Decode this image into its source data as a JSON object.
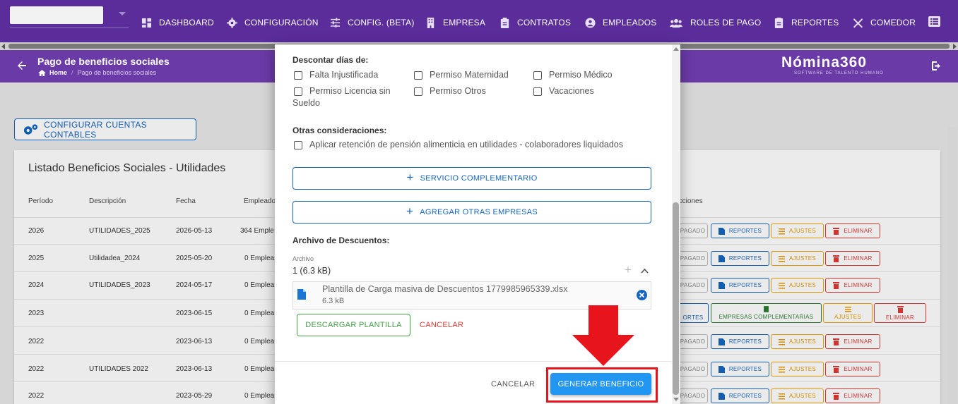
{
  "nav": {
    "items": [
      {
        "label": "DASHBOARD",
        "icon": "dashboard-icon"
      },
      {
        "label": "CONFIGURACIÓN",
        "icon": "gear-icon"
      },
      {
        "label": "CONFIG. (BETA)",
        "icon": "tune-icon"
      },
      {
        "label": "EMPRESA",
        "icon": "building-icon"
      },
      {
        "label": "CONTRATOS",
        "icon": "clipboard-icon"
      },
      {
        "label": "EMPLEADOS",
        "icon": "employees-icon"
      },
      {
        "label": "ROLES DE PAGO",
        "icon": "group-icon"
      },
      {
        "label": "REPORTES",
        "icon": "report-icon"
      },
      {
        "label": "COMEDOR",
        "icon": "cutlery-icon"
      }
    ]
  },
  "header": {
    "title": "Pago de beneficios sociales",
    "breadcrumb": {
      "home": "Home",
      "current": "Pago de beneficios sociales"
    },
    "logo": "Nómina360",
    "logo_sub": "SOFTWARE DE TALENTO HUMANO"
  },
  "background": {
    "config_button": "CONFIGURAR CUENTAS CONTABLES",
    "card_title": "Listado Beneficios Sociales - Utilidades",
    "columns": [
      "Período",
      "Descripción",
      "Fecha",
      "Empleado",
      "Acciones"
    ],
    "rows": [
      {
        "periodo": "2026",
        "descripcion": "UTILIDADES_2025",
        "fecha": "2026-05-13",
        "empleados": "364 Emple"
      },
      {
        "periodo": "2025",
        "descripcion": "Utilidadea_2024",
        "fecha": "2025-05-20",
        "empleados": "0 Emplea"
      },
      {
        "periodo": "2024",
        "descripcion": "UTILIDADES_2023",
        "fecha": "2024-05-17",
        "empleados": "0 Emplea"
      },
      {
        "periodo": "2023",
        "descripcion": "",
        "fecha": "2023-06-15",
        "empleados": "0 Emplea"
      },
      {
        "periodo": "2022",
        "descripcion": "",
        "fecha": "2023-06-13",
        "empleados": "0 Emplea"
      },
      {
        "periodo": "2022",
        "descripcion": "UTILIDADES 2022",
        "fecha": "2023-06-13",
        "empleados": "0 Emplea"
      },
      {
        "periodo": "2022",
        "descripcion": "",
        "fecha": "2023-05-29",
        "empleados": "0 Emplea"
      }
    ],
    "actions": {
      "pagado": "PAGADO",
      "reportes": "REPORTES",
      "ajustes": "AJUSTES",
      "eliminar": "ELIMINAR",
      "reportes_short": "ORTES",
      "empresas_complementarias": "EMPRESAS COMPLEMENTARIAS"
    }
  },
  "modal": {
    "descontar_label": "Descontar días de:",
    "descontar_options": [
      {
        "label": "Falta Injustificada",
        "checked": false
      },
      {
        "label": "Permiso Maternidad",
        "checked": false
      },
      {
        "label": "Permiso Médico",
        "checked": false
      },
      {
        "label": "Permiso Licencia sin",
        "label2": "Sueldo",
        "checked": false
      },
      {
        "label": "Permiso Otros",
        "checked": false
      },
      {
        "label": "Vacaciones",
        "checked": false
      }
    ],
    "otras_label": "Otras consideraciones:",
    "otras_option": "Aplicar retención de pensión alimenticia en utilidades - colaboradores liquidados",
    "servicio_button": "SERVICIO COMPLEMENTARIO",
    "agregar_button": "AGREGAR OTRAS EMPRESAS",
    "archivo_label": "Archivo de Descuentos:",
    "archivo_field_label": "Archivo",
    "archivo_count": "1 (6.3 kB)",
    "file": {
      "name": "Plantilla de Carga masiva de Descuentos 1779985965339.xlsx",
      "size": "6.3 kB"
    },
    "descargar_button": "DESCARGAR PLANTILLA",
    "cancelar_inner": "CANCELAR",
    "cancel_button": "CANCELAR",
    "generate_button": "GENERAR BENEFICIO"
  },
  "colors": {
    "nav_bg": "#5a2d9a",
    "header_bg": "#6a3aa6",
    "primary": "#1565c0",
    "generate": "#2196f3",
    "success": "#43a047",
    "danger": "#e53935",
    "annotation": "#e8141c"
  }
}
